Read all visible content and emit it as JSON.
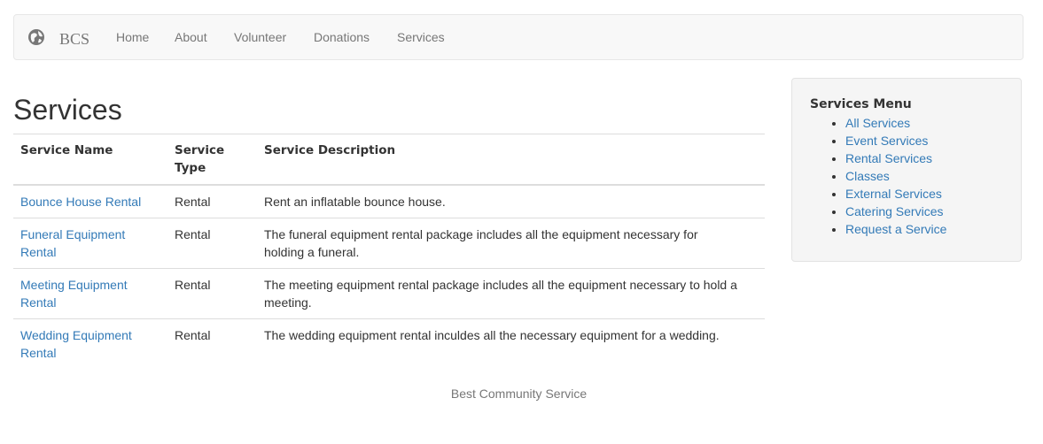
{
  "navbar": {
    "brand": "BCS",
    "links": [
      "Home",
      "About",
      "Volunteer",
      "Donations",
      "Services"
    ]
  },
  "page_title": "Services",
  "table": {
    "headers": [
      "Service Name",
      "Service Type",
      "Service Description"
    ],
    "rows": [
      {
        "name": "Bounce House Rental",
        "type": "Rental",
        "description": "Rent an inflatable bounce house."
      },
      {
        "name": "Funeral Equipment Rental",
        "type": "Rental",
        "description": "The funeral equipment rental package includes all the equipment necessary for holding a funeral."
      },
      {
        "name": "Meeting Equipment Rental",
        "type": "Rental",
        "description": "The meeting equipment rental package includes all the equipment necessary to hold a meeting."
      },
      {
        "name": "Wedding Equipment Rental",
        "type": "Rental",
        "description": "The wedding equipment rental inculdes all the necessary equipment for a wedding."
      }
    ]
  },
  "sidebar": {
    "title": "Services Menu",
    "items": [
      "All Services",
      "Event Services",
      "Rental Services",
      "Classes",
      "External Services",
      "Catering Services",
      "Request a Service"
    ]
  },
  "footer": {
    "text": "Best Community Service"
  },
  "colors": {
    "link": "#337ab7",
    "muted": "#777777",
    "navbar_bg": "#f8f8f8",
    "sidebar_bg": "#f5f5f5"
  }
}
